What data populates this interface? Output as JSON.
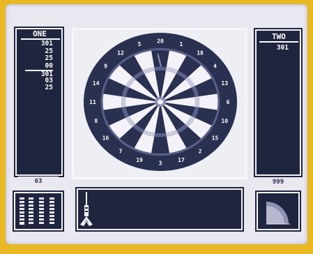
{
  "player_one": {
    "name": "ONE",
    "scores": [
      "301",
      "25",
      "25",
      "00",
      "301",
      "03",
      "25"
    ],
    "remaining": "63"
  },
  "player_two": {
    "name": "TWO",
    "scores": [
      "301"
    ],
    "remaining": "999"
  },
  "dartboard": {
    "numbers": [
      "20",
      "1",
      "18",
      "4",
      "13",
      "6",
      "10",
      "15",
      "2",
      "17",
      "3",
      "19",
      "7",
      "16",
      "8",
      "11",
      "14",
      "9",
      "12",
      "5"
    ]
  },
  "colors": {
    "frame": "#e9b825",
    "panel": "#20253f",
    "board_dark": "#2a3050",
    "board_light": "#f2f2f8",
    "screen": "#e9e8f1"
  },
  "icons": {
    "dart": "dart-icon",
    "power_gauge": "quarter-circle-gauge-icon"
  }
}
